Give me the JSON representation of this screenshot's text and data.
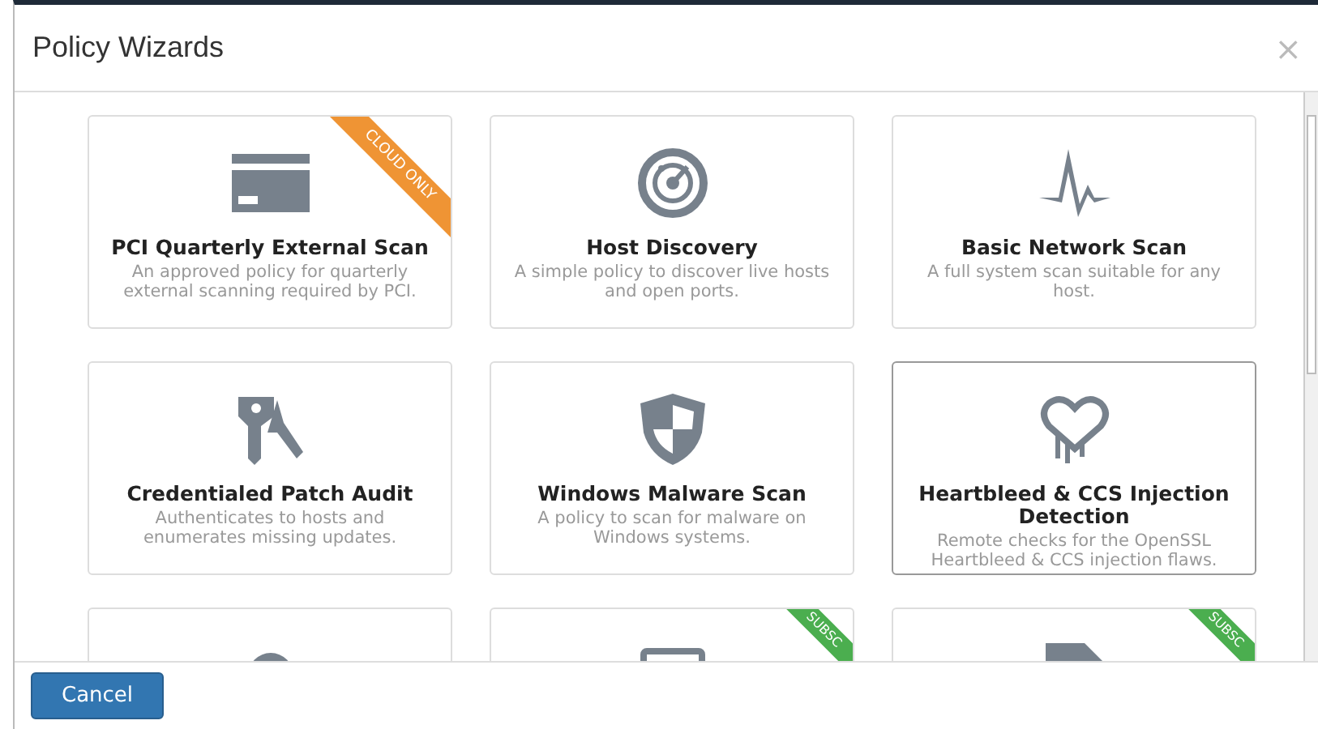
{
  "dialog": {
    "title": "Policy Wizards",
    "close": "×"
  },
  "cards": [
    {
      "title": "PCI Quarterly External Scan",
      "description": "An approved policy for quarterly external scanning required by PCI.",
      "selected": false,
      "ribbon": {
        "kind": "cloud",
        "text": "CLOUD ONLY"
      }
    },
    {
      "title": "Host Discovery",
      "description": "A simple policy to discover live hosts and open ports.",
      "selected": false
    },
    {
      "title": "Basic Network Scan",
      "description": "A full system scan suitable for any host.",
      "selected": false
    },
    {
      "title": "Credentialed Patch Audit",
      "description": "Authenticates to hosts and enumerates missing updates.",
      "selected": false
    },
    {
      "title": "Windows Malware Scan",
      "description": "A policy to scan for malware on Windows systems.",
      "selected": false
    },
    {
      "title": "Heartbleed & CCS Injection Detection",
      "description": "Remote checks for the OpenSSL Heartbleed & CCS injection flaws.",
      "selected": true
    },
    {
      "selected": false
    },
    {
      "selected": false,
      "ribbon": {
        "kind": "subscription",
        "text": "SUBSC"
      }
    },
    {
      "selected": false,
      "ribbon": {
        "kind": "subscription",
        "text": "SUBSC"
      }
    }
  ],
  "footer": {
    "button": "Cancel"
  }
}
